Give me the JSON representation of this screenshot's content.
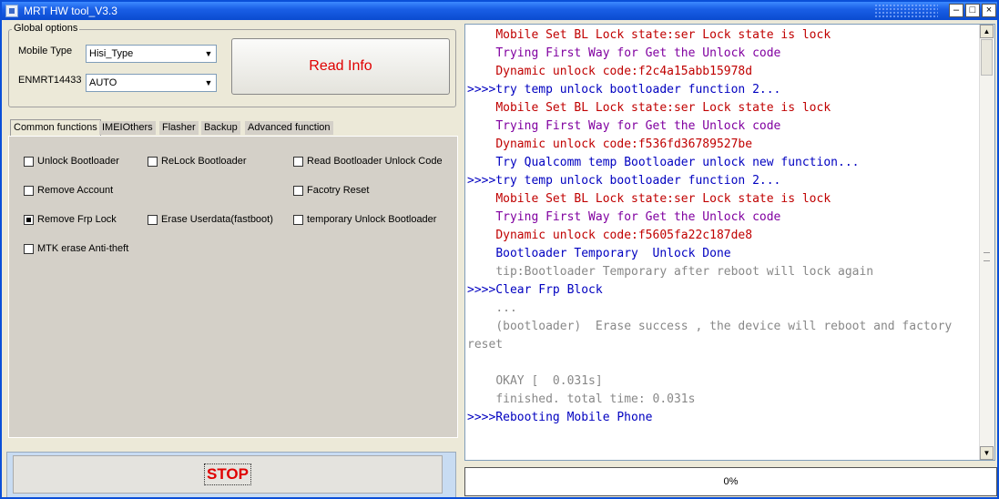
{
  "window": {
    "title": "MRT HW tool_V3.3"
  },
  "global_options": {
    "legend": "Global options",
    "mobile_type_label": "Mobile Type",
    "mobile_type_value": "Hisi_Type",
    "enmrt_label": "ENMRT14433",
    "enmrt_value": "AUTO",
    "read_info_label": "Read Info"
  },
  "tabs": [
    {
      "label": "Common functions",
      "active": true
    },
    {
      "label": "IMEIOthers"
    },
    {
      "label": "Flasher"
    },
    {
      "label": "Backup"
    },
    {
      "label": "Advanced function"
    }
  ],
  "functions": [
    {
      "label": "Unlock Bootloader",
      "kind": "checkbox",
      "checked": false
    },
    {
      "label": "ReLock Bootloader",
      "kind": "checkbox",
      "checked": false
    },
    {
      "label": "Read Bootloader Unlock Code",
      "kind": "checkbox",
      "checked": false
    },
    {
      "label": "Remove Account",
      "kind": "checkbox",
      "checked": false
    },
    {
      "label": "Facotry Reset",
      "kind": "checkbox",
      "checked": false
    },
    {
      "label": "Remove Frp Lock",
      "kind": "radio",
      "checked": true
    },
    {
      "label": "Erase Userdata(fastboot)",
      "kind": "checkbox",
      "checked": false
    },
    {
      "label": "temporary Unlock Bootloader",
      "kind": "checkbox",
      "checked": false
    },
    {
      "label": "MTK erase Anti-theft",
      "kind": "checkbox",
      "checked": false
    }
  ],
  "stop_label": "STOP",
  "log": [
    {
      "text": "    Mobile Set BL Lock state:ser Lock state is lock",
      "color": "#c00000"
    },
    {
      "text": "    Trying First Way for Get the Unlock code",
      "color": "#8000a0"
    },
    {
      "text": "    Dynamic unlock code:f2c4a15abb15978d",
      "color": "#c00000"
    },
    {
      "text": ">>>>try temp unlock bootloader function 2...",
      "color": "#0000c0"
    },
    {
      "text": "    Mobile Set BL Lock state:ser Lock state is lock",
      "color": "#c00000"
    },
    {
      "text": "    Trying First Way for Get the Unlock code",
      "color": "#8000a0"
    },
    {
      "text": "    Dynamic unlock code:f536fd36789527be",
      "color": "#c00000"
    },
    {
      "text": "    Try Qualcomm temp Bootloader unlock new function...",
      "color": "#0000c0"
    },
    {
      "text": ">>>>try temp unlock bootloader function 2...",
      "color": "#0000c0"
    },
    {
      "text": "    Mobile Set BL Lock state:ser Lock state is lock",
      "color": "#c00000"
    },
    {
      "text": "    Trying First Way for Get the Unlock code",
      "color": "#8000a0"
    },
    {
      "text": "    Dynamic unlock code:f5605fa22c187de8",
      "color": "#c00000"
    },
    {
      "text": "    Bootloader Temporary  Unlock Done",
      "color": "#0000c0"
    },
    {
      "text": "    tip:Bootloader Temporary after reboot will lock again",
      "color": "#888888"
    },
    {
      "text": ">>>>Clear Frp Block",
      "color": "#0000c0"
    },
    {
      "text": "    ...",
      "color": "#888888"
    },
    {
      "text": "    (bootloader)  Erase success , the device will reboot and factory reset",
      "color": "#888888"
    },
    {
      "text": "",
      "color": "#888888"
    },
    {
      "text": "    OKAY [  0.031s]",
      "color": "#888888"
    },
    {
      "text": "    finished. total time: 0.031s",
      "color": "#888888"
    },
    {
      "text": ">>>>Rebooting Mobile Phone",
      "color": "#0000c0"
    }
  ],
  "progress": {
    "value": 0,
    "label": "0%"
  }
}
